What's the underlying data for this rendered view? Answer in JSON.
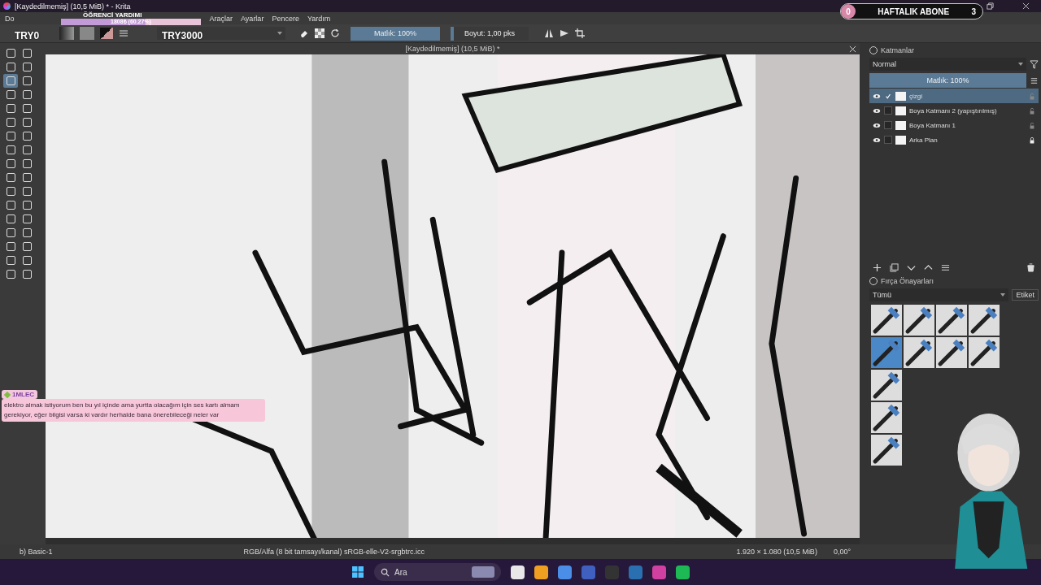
{
  "window": {
    "title": "[Kaydedilmemiş] (10,5 MiB) * - Krita"
  },
  "menu": [
    "Do",
    "Araçlar",
    "Ayarlar",
    "Pencere",
    "Yardım"
  ],
  "donation_overlay": {
    "title": "ÖĞRENCİ YARDIMI",
    "progress_text": "1808₺ (60.27%)",
    "level": 0.6027,
    "min_label": "TRY0",
    "max_label": "TRY3000"
  },
  "subscriber_overlay": {
    "current": "0",
    "label": "HAFTALIK ABONE",
    "goal": "3"
  },
  "toolbar": {
    "opacity": {
      "text": "Matlık: 100%",
      "level": 1
    },
    "size": {
      "text": "Boyut: 1,00 pks",
      "level": 0.04
    }
  },
  "document": {
    "tab_title": "[Kaydedilmemiş] (10,5 MiB) *"
  },
  "layers_panel": {
    "title": "Katmanlar",
    "blend_mode": "Normal",
    "opacity": {
      "text": "Matlık:  100%",
      "level": 1
    },
    "layers": [
      {
        "name": "çizgi",
        "selected": true,
        "locked": false
      },
      {
        "name": "Boya Katmanı 2 (yapıştırılmış)",
        "selected": false,
        "locked": false
      },
      {
        "name": "Boya Katmanı 1",
        "selected": false,
        "locked": false
      },
      {
        "name": "Arka Plan",
        "selected": false,
        "locked": true
      }
    ]
  },
  "brush_panel": {
    "title": "Fırça Önayarları",
    "filter": "Tümü",
    "tag_button": "Etiket",
    "brushes": [
      {
        "selected": false
      },
      {
        "selected": false
      },
      {
        "selected": false
      },
      {
        "selected": false
      },
      {
        "selected": true
      },
      {
        "selected": false
      },
      {
        "selected": false
      },
      {
        "selected": false
      },
      {
        "selected": false
      },
      {
        "selected": false
      },
      {
        "selected": false
      }
    ]
  },
  "chat": {
    "user": "1MLEC",
    "message": "elektro almak istiyorum ben bu yıl içinde ama yurtta olacağım için ses kartı almam gerekiyor, eğer bilgisi varsa ki vardır herhalde bana önerebileceği neler var"
  },
  "status_bar": {
    "brush": "b) Basic-1",
    "color_profile": "RGB/Alfa (8 bit tamsayı/kanal) sRGB-elle-V2-srgbtrc.icc",
    "dimensions": "1.920 × 1.080 (10,5 MiB)",
    "rotation": "0,00°"
  },
  "taskbar": {
    "search": "Ara"
  }
}
